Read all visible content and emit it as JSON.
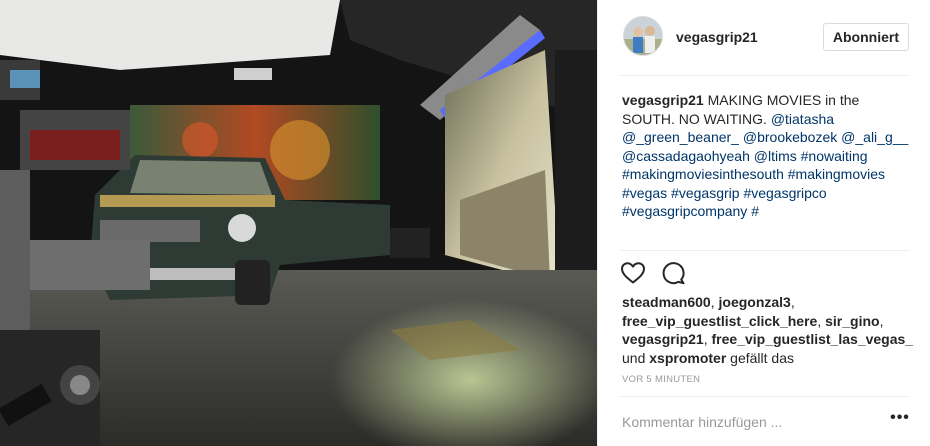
{
  "post": {
    "photo_icon": "film-set-photo",
    "account": {
      "username": "vegasgrip21",
      "avatar_icon": "avatar-photo",
      "follow_label": "Abonniert"
    },
    "caption": {
      "username": "vegasgrip21",
      "text": " MAKING MOVIES in the SOUTH. NO WAITING. ",
      "links": [
        "@tiatasha",
        " ",
        "@_green_beaner_",
        " ",
        "@brookebozek",
        " ",
        "@_ali_g__",
        " ",
        "@cassadagaohyeah",
        " ",
        "@ltims",
        " ",
        "#nowaiting",
        " ",
        "#makingmoviesinthesouth",
        " ",
        "#makingmovies",
        " ",
        "#vegas",
        " ",
        "#vegasgrip",
        " ",
        "#vegasgripco",
        " ",
        "#vegasgripcompany",
        " ",
        "#"
      ]
    },
    "actions": {
      "like_icon": "heart-icon",
      "comment_icon": "comment-icon"
    },
    "likes": {
      "users": [
        "steadman600",
        "joegonzal3",
        "free_vip_guestlist_click_here",
        "sir_gino",
        "vegasgrip21",
        "free_vip_guestlist_las_vegas_"
      ],
      "separator": ", ",
      "and_word": " und ",
      "last_user": "xspromoter",
      "suffix": " gefällt das"
    },
    "timestamp": "VOR 5 MINUTEN",
    "comment": {
      "placeholder": "Kommentar hinzufügen ...",
      "more_label": "•••"
    }
  }
}
